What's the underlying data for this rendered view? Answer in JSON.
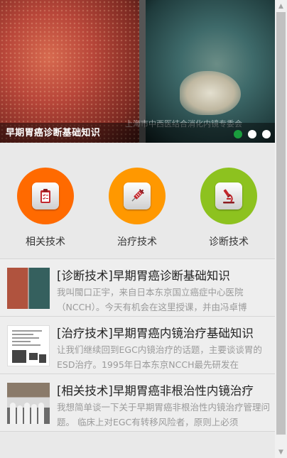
{
  "banner": {
    "title": "早期胃癌诊断基础知识",
    "watermark": "上海市中西医结合消化内镜专委会",
    "slide_count": 3,
    "active_slide": 1
  },
  "categories": [
    {
      "label": "相关技术",
      "icon": "clipboard-icon",
      "color": "#ff6a00"
    },
    {
      "label": "治疗技术",
      "icon": "syringe-icon",
      "color": "#ff9800"
    },
    {
      "label": "诊断技术",
      "icon": "microscope-icon",
      "color": "#8dc21f"
    }
  ],
  "articles": [
    {
      "title": "[诊断技术]早期胃癌诊断基础知识",
      "desc": "我叫閩口正宇，来自日本东京国立癌症中心医院（NCCH）。今天有机会在这里授课，并由冯卓博"
    },
    {
      "title": "[治疗技术]早期胃癌内镜治疗基础知识",
      "desc": "让我们继续回到EGC内镜治疗的话题，主要谈谈胃的ESD治疗。1995年日本东京NCCH最先研发在"
    },
    {
      "title": "[相关技术]早期胃癌非根治性内镜治疗",
      "desc": "我想简单谈一下关于早期胃癌非根治性内镜治疗管理问题。 临床上对EGC有转移风险者，原则上必须"
    }
  ]
}
